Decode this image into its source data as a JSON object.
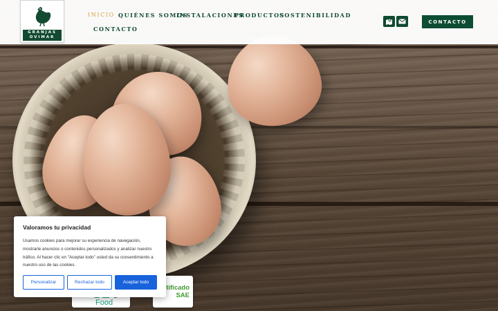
{
  "brand": {
    "logo_text_line1": "GRANJAS",
    "logo_text_line2": "OVIMAR",
    "accent_green": "#0f4a30",
    "active_gold": "#d7a33c"
  },
  "nav": {
    "items": [
      {
        "label": "INICIO",
        "active": true
      },
      {
        "label": "QUIÉNES SOMOS",
        "active": false
      },
      {
        "label": "INSTALACIONES",
        "active": false
      },
      {
        "label": "PRODUCTOS",
        "active": false
      },
      {
        "label": "SOSTENIBILIDAD",
        "active": false
      },
      {
        "label": "CONTACTO",
        "active": false
      }
    ]
  },
  "header_icons": [
    "map-location-icon",
    "envelope-icon"
  ],
  "header_cta": {
    "label": "CONTACTO"
  },
  "badges": {
    "food_label": "Food",
    "certificado_line1": "rtificado",
    "certificado_line2": "SAE"
  },
  "cookie_banner": {
    "title": "Valoramos tu privacidad",
    "body": "Usamos cookies para mejorar su experiencia de navegación, mostrarle anuncios o contenidos personalizados y analizar nuestro tráfico. Al hacer clic en \"Aceptar todo\" usted da su consentimiento a nuestro uso de las cookies.",
    "buttons": {
      "customize": "Personalizar",
      "reject": "Rechazar todo",
      "accept": "Aceptar todo"
    },
    "button_color": "#1863dc"
  }
}
